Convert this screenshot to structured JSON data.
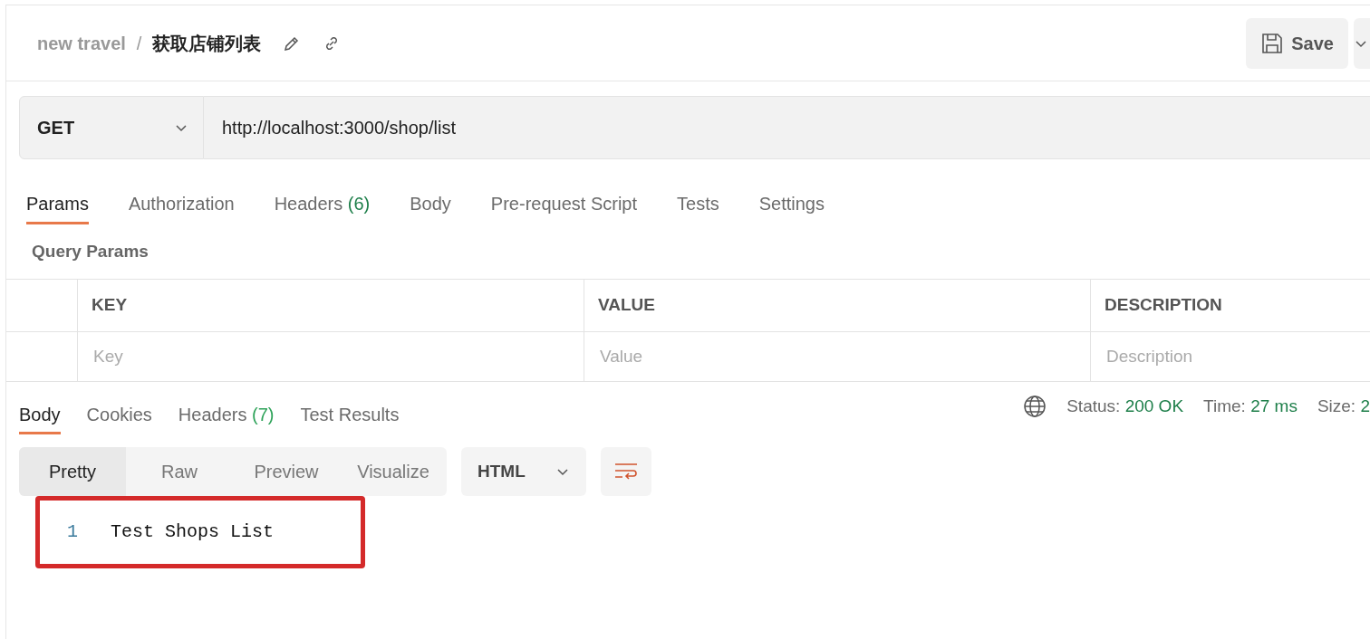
{
  "breadcrumb": {
    "collection": "new travel",
    "separator": "/",
    "request": "获取店铺列表"
  },
  "save": {
    "label": "Save"
  },
  "request": {
    "method": "GET",
    "url": "http://localhost:3000/shop/list"
  },
  "request_tabs": [
    {
      "label": "Params",
      "selected": true
    },
    {
      "label": "Authorization",
      "selected": false
    },
    {
      "label": "Headers",
      "count": "(6)",
      "selected": false
    },
    {
      "label": "Body",
      "selected": false
    },
    {
      "label": "Pre-request Script",
      "selected": false
    },
    {
      "label": "Tests",
      "selected": false
    },
    {
      "label": "Settings",
      "selected": false
    }
  ],
  "query_params": {
    "title": "Query Params",
    "columns": [
      "KEY",
      "VALUE",
      "DESCRIPTION"
    ],
    "placeholders": [
      "Key",
      "Value",
      "Description"
    ]
  },
  "response_tabs": [
    {
      "label": "Body",
      "selected": true
    },
    {
      "label": "Cookies",
      "selected": false
    },
    {
      "label": "Headers",
      "count": "(7)",
      "selected": false
    },
    {
      "label": "Test Results",
      "selected": false
    }
  ],
  "response_status": [
    {
      "label": "Status:",
      "value": "200 OK"
    },
    {
      "label": "Time:",
      "value": "27 ms"
    },
    {
      "label": "Size:",
      "value": "2"
    }
  ],
  "format_modes": [
    {
      "label": "Pretty",
      "selected": true
    },
    {
      "label": "Raw",
      "selected": false
    },
    {
      "label": "Preview",
      "selected": false
    },
    {
      "label": "Visualize",
      "selected": false
    }
  ],
  "language": "HTML",
  "code": {
    "highlighted": true,
    "lines": [
      {
        "number": "1",
        "text": "Test Shops List"
      }
    ]
  }
}
